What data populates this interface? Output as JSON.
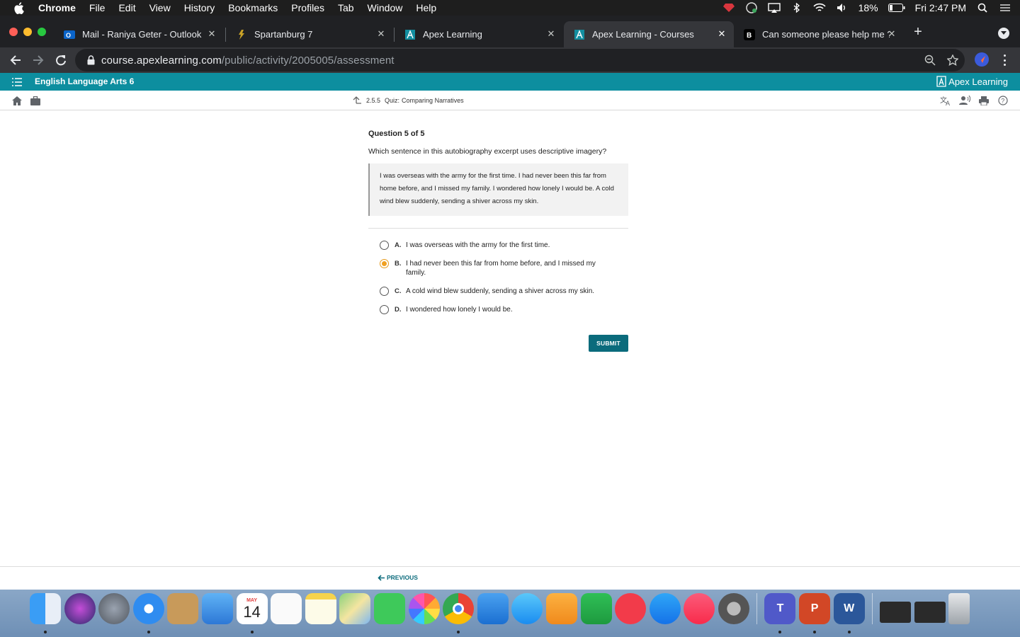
{
  "menubar": {
    "app": "Chrome",
    "items": [
      "File",
      "Edit",
      "View",
      "History",
      "Bookmarks",
      "Profiles",
      "Tab",
      "Window",
      "Help"
    ],
    "battery": "18%",
    "clock": "Fri 2:47 PM"
  },
  "tabs": [
    {
      "title": "Mail - Raniya Geter - Outlook",
      "icon": "outlook-icon"
    },
    {
      "title": "Spartanburg 7",
      "icon": "spartanburg-icon"
    },
    {
      "title": "Apex Learning",
      "icon": "apex-icon"
    },
    {
      "title": "Apex Learning - Courses",
      "icon": "apex-icon",
      "active": true
    },
    {
      "title": "Can someone please help me ?",
      "icon": "brainly-icon"
    }
  ],
  "address": {
    "host": "course.apexlearning.com",
    "path": "/public/activity/2005005/assessment"
  },
  "apex": {
    "course": "English Language Arts 6",
    "brand": "Apex Learning",
    "crumb_number": "2.5.5",
    "crumb_type": "Quiz:",
    "crumb_title": "Comparing Narratives"
  },
  "quiz": {
    "heading": "Question 5 of 5",
    "prompt": "Which sentence in this autobiography excerpt uses descriptive imagery?",
    "excerpt": "I was overseas with the army for the first time. I had never been this far from home before, and I missed my family. I wondered how lonely I would be. A cold wind blew suddenly, sending a shiver across my skin.",
    "answers": [
      {
        "letter": "A.",
        "text": "I was overseas with the army for the first time.",
        "selected": false
      },
      {
        "letter": "B.",
        "text": "I had never been this far from home before, and I missed my family.",
        "selected": true
      },
      {
        "letter": "C.",
        "text": "A cold wind blew suddenly, sending a shiver across my skin.",
        "selected": false
      },
      {
        "letter": "D.",
        "text": "I wondered how lonely I would be.",
        "selected": false
      }
    ],
    "submit": "SUBMIT"
  },
  "footer": {
    "previous": "PREVIOUS"
  },
  "dock": {
    "calendar_month": "MAY",
    "calendar_day": "14"
  },
  "colors": {
    "apex_teal": "#0d8e9f",
    "submit_dark_teal": "#0b6b7c",
    "selected_orange": "#f0a020"
  }
}
